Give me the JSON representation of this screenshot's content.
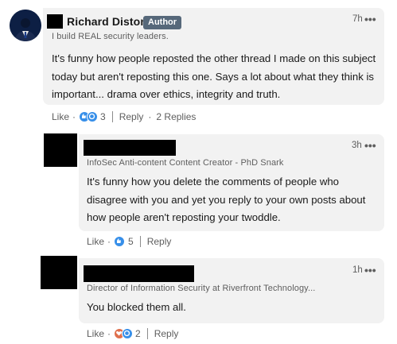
{
  "comments": [
    {
      "author": "Richard Diston",
      "badge": "Author",
      "headline": "I build REAL security leaders.",
      "time": "7h",
      "more": "•••",
      "text": "It's funny how people reposted the other thread I made on this subject today but aren't reposting this one. Says a lot about what they think is important... drama over ethics, integrity and truth.",
      "like_label": "Like",
      "reaction_count": "3",
      "reply_label": "Reply",
      "replies_label": "2 Replies",
      "reactions": [
        "like-reaction",
        "support-reaction"
      ]
    },
    {
      "author": "",
      "headline": "InfoSec Anti-content Content Creator - PhD Snark",
      "time": "3h",
      "more": "•••",
      "text": "It's funny how you delete the comments of people who disagree with you and yet you reply to your own posts about how people aren't reposting your twoddle.",
      "like_label": "Like",
      "reaction_count": "5",
      "reply_label": "Reply",
      "reactions": [
        "like-reaction"
      ]
    },
    {
      "author": "",
      "headline": "Director of Information Security at Riverfront Technology...",
      "time": "1h",
      "more": "•••",
      "text": "You blocked them all.",
      "like_label": "Like",
      "reaction_count": "2",
      "reply_label": "Reply",
      "reactions": [
        "love-reaction",
        "support-reaction"
      ]
    }
  ],
  "colors": {
    "bubble": "#f2f2f2",
    "badge": "#56687a",
    "like_blue": "#378fe9",
    "love_red": "#df704d",
    "support_teal": "#6dae4f"
  },
  "separator": "·"
}
